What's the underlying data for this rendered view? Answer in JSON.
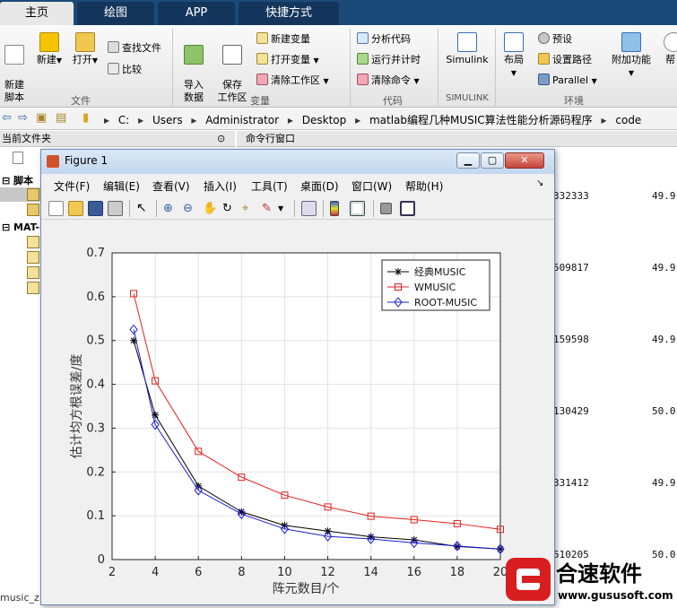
{
  "tabs": [
    {
      "label": "主页"
    },
    {
      "label": "绘图"
    },
    {
      "label": "APP"
    },
    {
      "label": "快捷方式"
    }
  ],
  "ribbon": {
    "file": {
      "new_script": "新建\n脚本",
      "new": "新建",
      "open": "打开",
      "find_files": "查找文件",
      "compare": "比较",
      "section": "文件"
    },
    "variable": {
      "import": "导入\n数据",
      "save_workspace": "保存\n工作区",
      "new_variable": "新建变量",
      "open_variable": "打开变量",
      "clear_workspace": "清除工作区",
      "section": "变量"
    },
    "code": {
      "analyze": "分析代码",
      "run_timing": "运行并计时",
      "clear_commands": "清除命令",
      "section": "代码"
    },
    "simulink": {
      "button": "Simulink",
      "section": "SIMULINK"
    },
    "environment": {
      "layout": "布局",
      "preferences": "预设",
      "set_path": "设置路径",
      "parallel": "Parallel",
      "addons": "附加功能",
      "help": "帮",
      "section": "环境"
    }
  },
  "address": {
    "crumbs": [
      "C:",
      "Users",
      "Administrator",
      "Desktop",
      "matlab编程几种MUSIC算法性能分析源码程序",
      "code"
    ]
  },
  "panels": {
    "current_folder": "当前文件夹",
    "command_window": "命令行窗口",
    "tree_scripts": "脚本",
    "tree_mat": "MAT-",
    "status_file": "music_z"
  },
  "command_output": [
    {
      "left": "332333",
      "right": "49.9"
    },
    {
      "left": "509817",
      "right": "49.9"
    },
    {
      "left": "159598",
      "right": "49.9"
    },
    {
      "left": "130429",
      "right": "50.0"
    },
    {
      "left": "331412",
      "right": "49.9"
    },
    {
      "left": "510205",
      "right": "50.0"
    }
  ],
  "figure": {
    "title": "Figure 1",
    "menu": [
      "文件(F)",
      "编辑(E)",
      "查看(V)",
      "插入(I)",
      "工具(T)",
      "桌面(D)",
      "窗口(W)",
      "帮助(H)"
    ]
  },
  "chart_data": {
    "type": "line",
    "xlabel": "阵元数目/个",
    "ylabel": "估计均方根误差/度",
    "xlim": [
      2,
      20
    ],
    "ylim": [
      0,
      0.7
    ],
    "xticks": [
      2,
      4,
      6,
      8,
      10,
      12,
      14,
      16,
      18,
      20
    ],
    "yticks": [
      0,
      0.1,
      0.2,
      0.3,
      0.4,
      0.5,
      0.6,
      0.7
    ],
    "grid": true,
    "legend_position": "top-right",
    "x": [
      3,
      4,
      6,
      8,
      10,
      12,
      14,
      16,
      18,
      20
    ],
    "series": [
      {
        "name": "经典MUSIC",
        "color": "#000000",
        "marker": "asterisk",
        "values": [
          0.5,
          0.33,
          0.168,
          0.109,
          0.078,
          0.065,
          0.052,
          0.045,
          0.03,
          0.024
        ]
      },
      {
        "name": "WMUSIC",
        "color": "#e32020",
        "marker": "square",
        "values": [
          0.607,
          0.408,
          0.247,
          0.188,
          0.147,
          0.12,
          0.099,
          0.091,
          0.082,
          0.069
        ]
      },
      {
        "name": "ROOT-MUSIC",
        "color": "#1c1cd8",
        "marker": "diamond",
        "values": [
          0.525,
          0.308,
          0.158,
          0.104,
          0.07,
          0.053,
          0.047,
          0.038,
          0.031,
          0.024
        ]
      }
    ]
  },
  "watermark": {
    "brand": "合速软件",
    "url": "www.gususoft.com"
  }
}
